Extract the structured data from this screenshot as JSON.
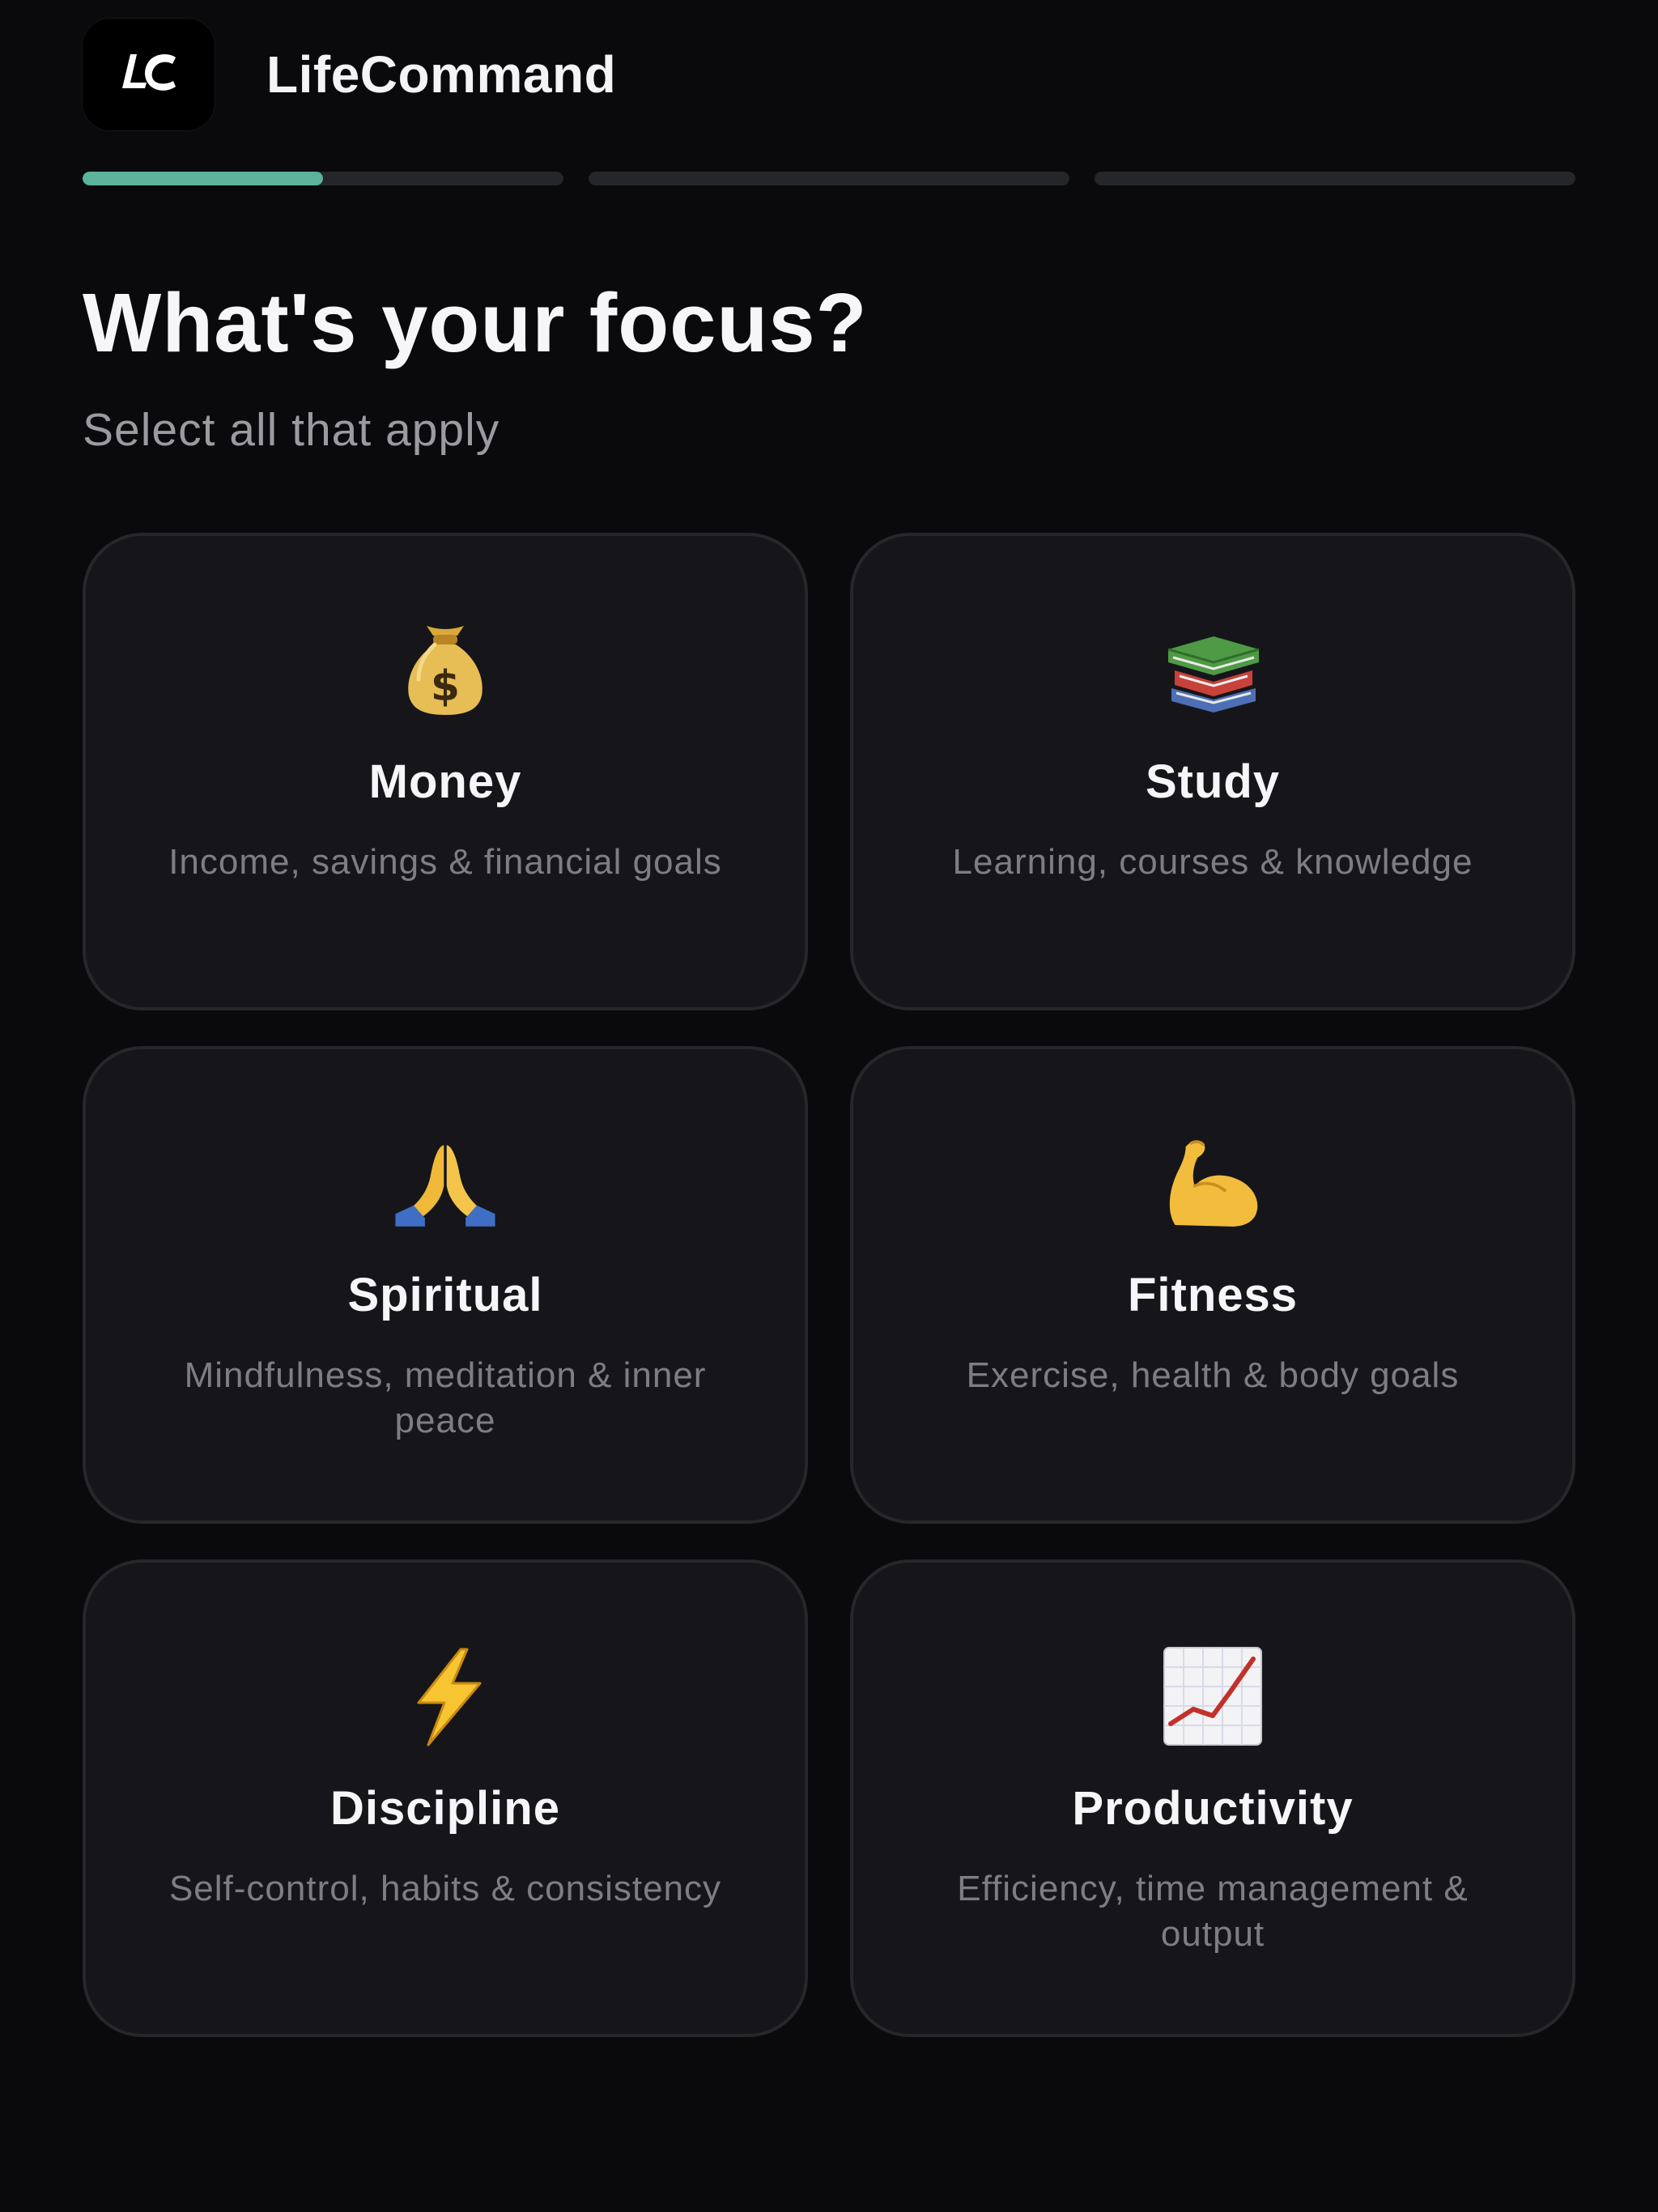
{
  "app": {
    "name": "LifeCommand",
    "logo_text": "LC",
    "logo_icon": "lc-logo-icon"
  },
  "progress": {
    "steps_total": 3,
    "current_step": 1,
    "current_step_fraction": 0.5,
    "active_color": "#5bb39c",
    "track_color": "#25262a"
  },
  "page": {
    "title": "What's your focus?",
    "subtitle": "Select all that apply"
  },
  "focus_options": [
    {
      "label": "Money",
      "description": "Income, savings & financial goals",
      "icon": "money-bag-icon"
    },
    {
      "label": "Study",
      "description": "Learning, courses & knowledge",
      "icon": "books-icon"
    },
    {
      "label": "Spiritual",
      "description": "Mindfulness, meditation & inner peace",
      "icon": "praying-hands-icon"
    },
    {
      "label": "Fitness",
      "description": "Exercise, health & body goals",
      "icon": "flexed-biceps-icon"
    },
    {
      "label": "Discipline",
      "description": "Self-control, habits & consistency",
      "icon": "lightning-bolt-icon"
    },
    {
      "label": "Productivity",
      "description": "Efficiency, time management & output",
      "icon": "chart-increasing-icon"
    }
  ],
  "colors": {
    "background": "#0a0a0c",
    "card_background": "#16161a",
    "card_border": "#26272b",
    "text_primary": "#f6f6f8",
    "text_secondary": "#7d7d84"
  }
}
